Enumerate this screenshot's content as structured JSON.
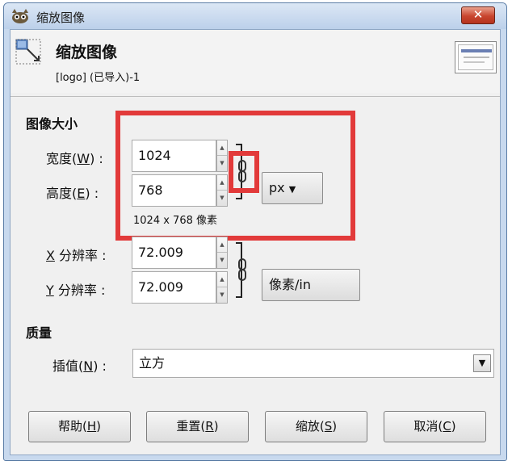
{
  "window": {
    "title": "缩放图像",
    "close_label": "✕"
  },
  "header": {
    "title": "缩放图像",
    "subtitle": "[logo] (已导入)-1"
  },
  "image_size": {
    "section_label": "图像大小",
    "width": {
      "label_prefix": "宽度(",
      "mnemonic": "W",
      "label_suffix": ") :",
      "value": "1024"
    },
    "height": {
      "label_prefix": "高度(",
      "mnemonic": "E",
      "label_suffix": ") :",
      "value": "768"
    },
    "unit": "px",
    "size_info": "1024 x 768 像素"
  },
  "resolution": {
    "x": {
      "mnemonic": "X",
      "label_suffix": " 分辨率 :",
      "value": "72.009"
    },
    "y": {
      "mnemonic": "Y",
      "label_suffix": " 分辨率 :",
      "value": "72.009"
    },
    "unit": "像素/in"
  },
  "quality": {
    "section_label": "质量",
    "interpolation": {
      "label_prefix": "插值(",
      "mnemonic": "N",
      "label_suffix": ") :",
      "value": "立方"
    }
  },
  "buttons": {
    "help": {
      "prefix": "帮助(",
      "mnemonic": "H",
      "suffix": ")"
    },
    "reset": {
      "prefix": "重置(",
      "mnemonic": "R",
      "suffix": ")"
    },
    "scale": {
      "prefix": "缩放(",
      "mnemonic": "S",
      "suffix": ")"
    },
    "cancel": {
      "prefix": "取消(",
      "mnemonic": "C",
      "suffix": ")"
    }
  },
  "colors": {
    "highlight": "#e23a3a",
    "titlebar": "#c8d9ee",
    "close_button": "#c8452f"
  }
}
